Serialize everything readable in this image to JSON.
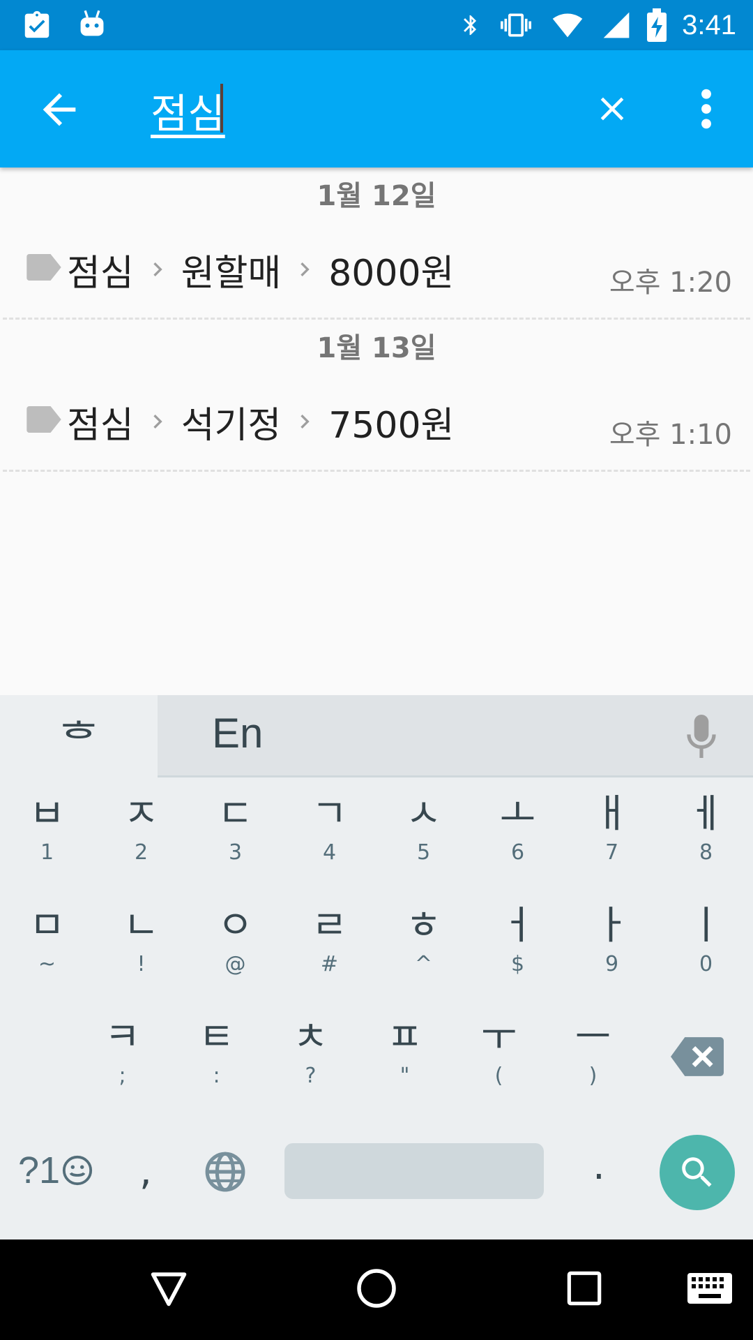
{
  "status_bar": {
    "time": "3:41",
    "icons": [
      "task-icon",
      "android-icon",
      "bluetooth-icon",
      "vibrate-icon",
      "wifi-icon",
      "signal-icon",
      "battery-charging-icon"
    ]
  },
  "app_bar": {
    "search_query": "점심",
    "back_icon": "arrow-back-icon",
    "clear_icon": "close-icon",
    "more_icon": "more-vert-icon"
  },
  "results": [
    {
      "date": "1월 12일",
      "entries": [
        {
          "path": [
            "점심",
            "원할매",
            "8000원"
          ],
          "time": "오후 1:20"
        }
      ]
    },
    {
      "date": "1월 13일",
      "entries": [
        {
          "path": [
            "점심",
            "석기정",
            "7500원"
          ],
          "time": "오후 1:10"
        }
      ]
    }
  ],
  "keyboard": {
    "lang_hangul": "ᄒ",
    "lang_en": "En",
    "row1": [
      {
        "main": "ㅂ",
        "sub": "1"
      },
      {
        "main": "ㅈ",
        "sub": "2"
      },
      {
        "main": "ㄷ",
        "sub": "3"
      },
      {
        "main": "ㄱ",
        "sub": "4"
      },
      {
        "main": "ㅅ",
        "sub": "5"
      },
      {
        "main": "ㅗ",
        "sub": "6"
      },
      {
        "main": "ㅐ",
        "sub": "7"
      },
      {
        "main": "ㅔ",
        "sub": "8"
      }
    ],
    "row2": [
      {
        "main": "ㅁ",
        "sub": "~"
      },
      {
        "main": "ㄴ",
        "sub": "!"
      },
      {
        "main": "ㅇ",
        "sub": "@"
      },
      {
        "main": "ㄹ",
        "sub": "#"
      },
      {
        "main": "ㅎ",
        "sub": "^"
      },
      {
        "main": "ㅓ",
        "sub": "$"
      },
      {
        "main": "ㅏ",
        "sub": "9"
      },
      {
        "main": "ㅣ",
        "sub": "0"
      }
    ],
    "row3": [
      {
        "main": "ㅋ",
        "sub": ";"
      },
      {
        "main": "ㅌ",
        "sub": ":"
      },
      {
        "main": "ㅊ",
        "sub": "?"
      },
      {
        "main": "ㅍ",
        "sub": "\""
      },
      {
        "main": "ㅜ",
        "sub": "("
      },
      {
        "main": "ㅡ",
        "sub": ")"
      }
    ],
    "symbols_label": "?1",
    "comma": ",",
    "period": "."
  },
  "colors": {
    "status_bar": "#0288d1",
    "app_bar": "#03a9f4",
    "search_key": "#4db6ac",
    "keyboard_bg": "#eceff1"
  }
}
